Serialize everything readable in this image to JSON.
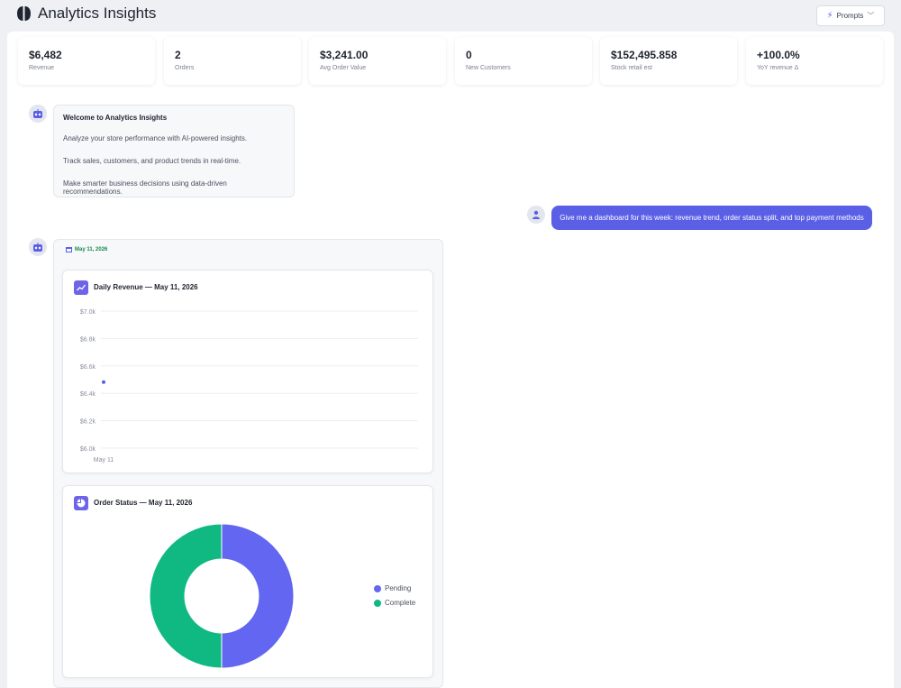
{
  "header": {
    "title": "Analytics Insights",
    "prompts_label": "Prompts"
  },
  "stats": [
    {
      "value": "$6,482",
      "label": "Revenue"
    },
    {
      "value": "2",
      "label": "Orders"
    },
    {
      "value": "$3,241.00",
      "label": "Avg Order Value"
    },
    {
      "value": "0",
      "label": "New Customers"
    },
    {
      "value": "$152,495.858",
      "label": "Stock retail est"
    },
    {
      "value": "+100.0%",
      "label": "YoY revenue Δ"
    }
  ],
  "welcome": {
    "title": "Welcome to Analytics Insights",
    "lines": [
      "Analyze your store performance with AI-powered insights.",
      "Track sales, customers, and product trends in real-time.",
      "Make smarter business decisions using data-driven recommendations."
    ]
  },
  "user_message": "Give me a dashboard for this week: revenue trend, order status split, and top payment methods",
  "response": {
    "date": "May 11, 2026"
  },
  "revenue_card": {
    "title": "Daily Revenue — May 11, 2026"
  },
  "status_card": {
    "title": "Order Status — May 11, 2026"
  },
  "chart_data": [
    {
      "type": "line",
      "title": "Daily Revenue — May 11, 2026",
      "x": [
        "May 11"
      ],
      "series": [
        {
          "values": [
            6482
          ]
        }
      ],
      "y_ticks": [
        "$7.0k",
        "$6.8k",
        "$6.6k",
        "$6.4k",
        "$6.2k",
        "$6.0k"
      ],
      "ylim": [
        6000,
        7000
      ],
      "grid": true,
      "color": "#5b5fe6"
    },
    {
      "type": "pie",
      "title": "Order Status — May 11, 2026",
      "labels": [
        "Pending",
        "Complete"
      ],
      "values": [
        1,
        1
      ],
      "colors": [
        "#6366f1",
        "#10b981"
      ],
      "legend": "right"
    }
  ]
}
